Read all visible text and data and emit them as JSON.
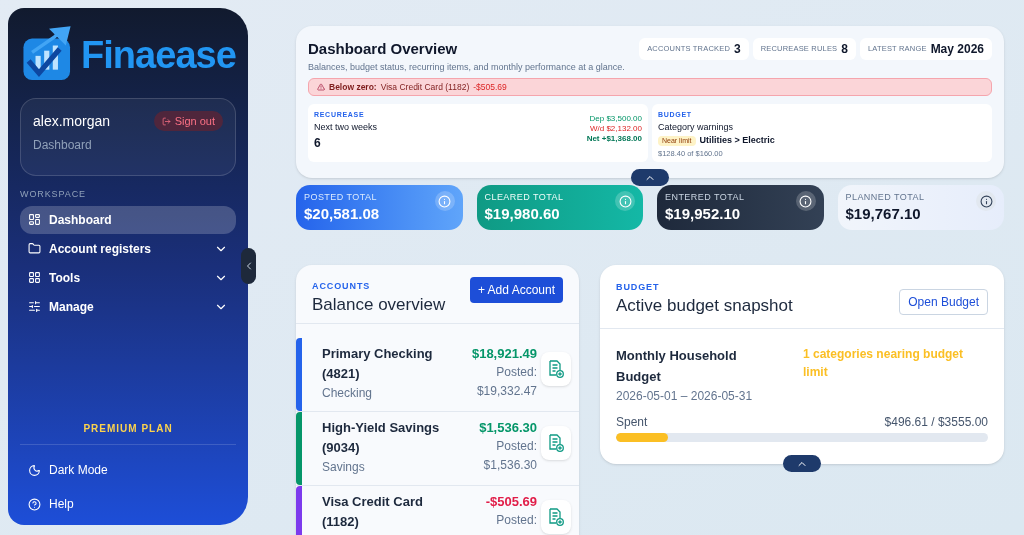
{
  "sidebar": {
    "logo": "Finaease",
    "user": {
      "name": "alex.morgan",
      "page": "Dashboard",
      "sign_out": "Sign out"
    },
    "section": "WORKSPACE",
    "items": [
      {
        "label": "Dashboard",
        "selected": true,
        "expandable": false
      },
      {
        "label": "Account registers",
        "selected": false,
        "expandable": true
      },
      {
        "label": "Tools",
        "selected": false,
        "expandable": true
      },
      {
        "label": "Manage",
        "selected": false,
        "expandable": true
      }
    ],
    "plan": "PREMIUM PLAN",
    "bottom": [
      {
        "label": "Dark Mode"
      },
      {
        "label": "Help"
      }
    ]
  },
  "overview": {
    "title": "Dashboard Overview",
    "subtitle": "Balances, budget status, recurring items, and monthly performance at a glance.",
    "chips": [
      {
        "label": "ACCOUNTS TRACKED",
        "value": "3"
      },
      {
        "label": "RECUREASE RULES",
        "value": "8"
      },
      {
        "label": "LATEST RANGE",
        "value": "May 2026"
      }
    ],
    "alert": {
      "label": "Below zero:",
      "account": "Visa Credit Card (1182)",
      "amount": "-$505.69"
    },
    "recurease": {
      "eyebrow": "RECUREASE",
      "title": "Next two weeks",
      "count": "6",
      "dep": "Dep $3,500.00",
      "wd": "W/d $2,132.00",
      "net": "Net +$1,368.00"
    },
    "budget": {
      "eyebrow": "BUDGET",
      "title": "Category warnings",
      "badge": "Near limit",
      "category": "Utilities > Electric",
      "amount": "$128.40 of $160.00"
    }
  },
  "totals": [
    {
      "label": "POSTED TOTAL",
      "value": "$20,581.08",
      "kind": "blue"
    },
    {
      "label": "CLEARED TOTAL",
      "value": "$19,980.60",
      "kind": "teal"
    },
    {
      "label": "ENTERED TOTAL",
      "value": "$19,952.10",
      "kind": "dark"
    },
    {
      "label": "PLANNED TOTAL",
      "value": "$19,767.10",
      "kind": "light"
    }
  ],
  "accounts": {
    "eyebrow": "ACCOUNTS",
    "title": "Balance overview",
    "add": "+ Add Account",
    "rows": [
      {
        "name": "Primary Checking (4821)",
        "type": "Checking",
        "balance": "$18,921.49",
        "negative": false,
        "posted_label": "Posted:",
        "posted": "$19,332.47",
        "color": "#2563eb"
      },
      {
        "name": "High-Yield Savings (9034)",
        "type": "Savings",
        "balance": "$1,536.30",
        "negative": false,
        "posted_label": "Posted:",
        "posted": "$1,536.30",
        "color": "#059669"
      },
      {
        "name": "Visa Credit Card (1182)",
        "balance": "-$505.69",
        "negative": true,
        "posted_label": "Posted:",
        "color": "#7c3aed"
      }
    ]
  },
  "budget_card": {
    "eyebrow": "BUDGET",
    "title": "Active budget snapshot",
    "open": "Open Budget",
    "name": "Monthly Household Budget",
    "dates": "2026-05-01 – 2026-05-31",
    "warning": "1 categories nearing budget limit",
    "spent_label": "Spent",
    "spent": "$496.61 / $3555.00",
    "level": 0.14
  }
}
